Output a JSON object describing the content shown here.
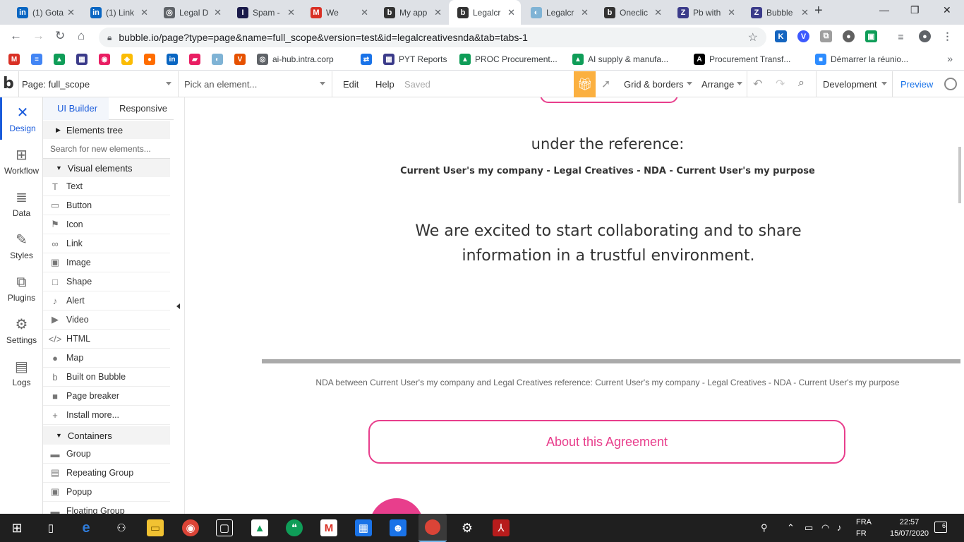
{
  "browser": {
    "tabs": [
      {
        "title": "(1) Gota",
        "color": "#0a66c2",
        "glyph": "in"
      },
      {
        "title": "(1) Link",
        "color": "#0a66c2",
        "glyph": "in"
      },
      {
        "title": "Legal D",
        "color": "#5f6368",
        "glyph": "◎"
      },
      {
        "title": "Spam -",
        "color": "#1a1a4a",
        "glyph": "I"
      },
      {
        "title": "We",
        "color": "#d93025",
        "glyph": "M"
      },
      {
        "title": "My app",
        "color": "#333333",
        "glyph": "b"
      },
      {
        "title": "Legalcr",
        "color": "#333333",
        "glyph": "b"
      },
      {
        "title": "Legalcr",
        "color": "#7fb3d5",
        "glyph": "◐"
      },
      {
        "title": "Oneclic",
        "color": "#333333",
        "glyph": "b"
      },
      {
        "title": "Pb with",
        "color": "#3b3b8a",
        "glyph": "Z"
      },
      {
        "title": "Bubble",
        "color": "#3b3b8a",
        "glyph": "Z"
      }
    ],
    "url": "bubble.io/page?type=page&name=full_scope&version=test&id=legalcreativesnda&tab=tabs-1",
    "bookmarks": [
      {
        "label": "",
        "color": "#d93025",
        "glyph": "M"
      },
      {
        "label": "",
        "color": "#4285f4",
        "glyph": "≡"
      },
      {
        "label": "",
        "color": "#0f9d58",
        "glyph": "▲"
      },
      {
        "label": "",
        "color": "#3b3b8a",
        "glyph": "▦"
      },
      {
        "label": "",
        "color": "#e91e63",
        "glyph": "◉"
      },
      {
        "label": "",
        "color": "#fbbc04",
        "glyph": "◈"
      },
      {
        "label": "",
        "color": "#ff6d00",
        "glyph": "●"
      },
      {
        "label": "",
        "color": "#0a66c2",
        "glyph": "in"
      },
      {
        "label": "",
        "color": "#e91e63",
        "glyph": "▰"
      },
      {
        "label": "",
        "color": "#7fb3d5",
        "glyph": "◐"
      },
      {
        "label": "",
        "color": "#e65100",
        "glyph": "V"
      },
      {
        "label": "ai-hub.intra.corp",
        "color": "#5f6368",
        "glyph": "◎"
      },
      {
        "label": "",
        "color": "#1a73e8",
        "glyph": "⇄"
      },
      {
        "label": "PYT Reports",
        "color": "#3b3b8a",
        "glyph": "▦"
      },
      {
        "label": "PROC Procurement...",
        "color": "#0f9d58",
        "glyph": "▲"
      },
      {
        "label": "AI supply & manufa...",
        "color": "#0f9d58",
        "glyph": "▲"
      },
      {
        "label": "Procurement Transf...",
        "color": "#000000",
        "glyph": "A"
      },
      {
        "label": "Démarrer la réunio...",
        "color": "#2d8cff",
        "glyph": "■"
      }
    ]
  },
  "editor": {
    "page_label": "Page: full_scope",
    "pick_element": "Pick an element...",
    "edit": "Edit",
    "help": "Help",
    "saved": "Saved",
    "grid_borders": "Grid & borders",
    "arrange": "Arrange",
    "development": "Development",
    "preview": "Preview"
  },
  "rail": [
    {
      "label": "Design",
      "icon": "✕"
    },
    {
      "label": "Workflow",
      "icon": "⊞"
    },
    {
      "label": "Data",
      "icon": "≣"
    },
    {
      "label": "Styles",
      "icon": "✎"
    },
    {
      "label": "Plugins",
      "icon": "⧉"
    },
    {
      "label": "Settings",
      "icon": "⚙"
    },
    {
      "label": "Logs",
      "icon": "▤"
    }
  ],
  "panel": {
    "tab_ui_builder": "UI Builder",
    "tab_responsive": "Responsive",
    "elements_tree": "Elements tree",
    "search_placeholder": "Search for new elements...",
    "visual_elements": "Visual elements",
    "visual_items": [
      {
        "label": "Text",
        "icon": "T"
      },
      {
        "label": "Button",
        "icon": "▭"
      },
      {
        "label": "Icon",
        "icon": "⚑"
      },
      {
        "label": "Link",
        "icon": "∞"
      },
      {
        "label": "Image",
        "icon": "▣"
      },
      {
        "label": "Shape",
        "icon": "□"
      },
      {
        "label": "Alert",
        "icon": "♪"
      },
      {
        "label": "Video",
        "icon": "▶"
      },
      {
        "label": "HTML",
        "icon": "</>"
      },
      {
        "label": "Map",
        "icon": "●"
      },
      {
        "label": "Built on Bubble",
        "icon": "b"
      },
      {
        "label": "Page breaker",
        "icon": "■"
      },
      {
        "label": "Install more...",
        "icon": "+"
      }
    ],
    "containers": "Containers",
    "container_items": [
      {
        "label": "Group",
        "icon": "▬"
      },
      {
        "label": "Repeating Group",
        "icon": "▤"
      },
      {
        "label": "Popup",
        "icon": "▣"
      },
      {
        "label": "Floating Group",
        "icon": "▬"
      }
    ]
  },
  "canvas": {
    "reference_heading": "under the reference:",
    "reference_line": "Current User's my company - Legal Creatives - NDA - Current User's my purpose",
    "excited_text": "We are excited to start collaborating and to share information in a trustful environment.",
    "nda_line": "NDA between Current User's my company and Legal Creatives reference: Current User's my company - Legal Creatives - NDA - Current User's my purpose",
    "about_button": "About this Agreement",
    "accent_color": "#e83e8c"
  },
  "taskbar": {
    "lang_top": "FRA",
    "lang_bottom": "FR",
    "time": "22:57",
    "date": "15/07/2020",
    "notifications": "6"
  }
}
